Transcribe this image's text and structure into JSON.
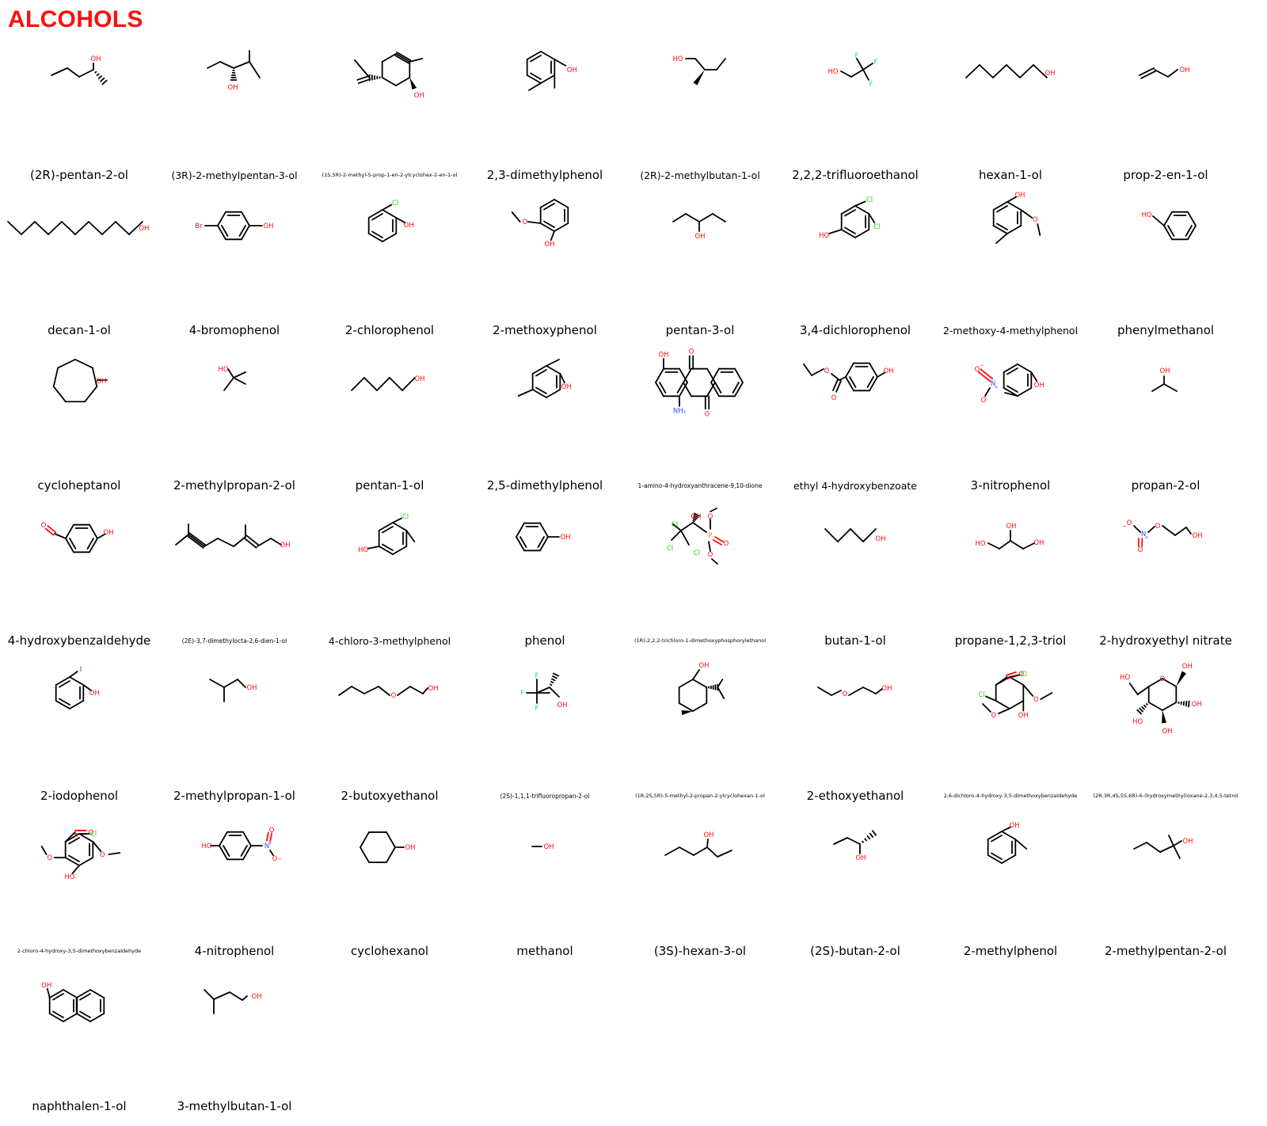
{
  "title": "ALCOHOLS",
  "colors": {
    "title": "#ff0d0d",
    "bond": "#000000",
    "O": "#ff0d0d",
    "N": "#3050f8",
    "Cl": "#1fd01f",
    "Br": "#a62929",
    "I": "#940094",
    "F": "#22c8d8",
    "P": "#ff8000"
  },
  "compounds": [
    {
      "name": "(2R)-pentan-2-ol",
      "structure": "pentan-2-ol skeletal structure"
    },
    {
      "name": "(3R)-2-methylpentan-3-ol",
      "structure": "2-methylpentan-3-ol skeletal structure"
    },
    {
      "name": "(1S,5R)-2-methyl-5-prop-1-en-2-ylcyclohex-2-en-1-ol",
      "structure": "carveol skeletal structure"
    },
    {
      "name": "2,3-dimethylphenol",
      "structure": "dimethylphenol skeletal structure"
    },
    {
      "name": "(2R)-2-methylbutan-1-ol",
      "structure": "2-methylbutan-1-ol skeletal structure"
    },
    {
      "name": "2,2,2-trifluoroethanol",
      "structure": "trifluoroethanol skeletal structure"
    },
    {
      "name": "hexan-1-ol",
      "structure": "hexanol skeletal structure"
    },
    {
      "name": "prop-2-en-1-ol",
      "structure": "allyl alcohol skeletal structure"
    },
    {
      "name": "decan-1-ol",
      "structure": "decanol skeletal structure"
    },
    {
      "name": "4-bromophenol",
      "structure": "bromophenol skeletal structure"
    },
    {
      "name": "2-chlorophenol",
      "structure": "chlorophenol skeletal structure"
    },
    {
      "name": "2-methoxyphenol",
      "structure": "guaiacol skeletal structure"
    },
    {
      "name": "pentan-3-ol",
      "structure": "pentan-3-ol skeletal structure"
    },
    {
      "name": "3,4-dichlorophenol",
      "structure": "dichlorophenol skeletal structure"
    },
    {
      "name": "2-methoxy-4-methylphenol",
      "structure": "creosol skeletal structure"
    },
    {
      "name": "phenylmethanol",
      "structure": "benzyl alcohol skeletal structure"
    },
    {
      "name": "cycloheptanol",
      "structure": "cycloheptanol skeletal structure"
    },
    {
      "name": "2-methylpropan-2-ol",
      "structure": "tert-butanol skeletal structure"
    },
    {
      "name": "pentan-1-ol",
      "structure": "pentanol skeletal structure"
    },
    {
      "name": "2,5-dimethylphenol",
      "structure": "dimethylphenol skeletal structure"
    },
    {
      "name": "1-amino-4-hydroxyanthracene-9,10-dione",
      "structure": "aminohydroxyanthraquinone skeletal structure"
    },
    {
      "name": "ethyl 4-hydroxybenzoate",
      "structure": "ethylparaben skeletal structure"
    },
    {
      "name": "3-nitrophenol",
      "structure": "3-nitrophenol skeletal structure"
    },
    {
      "name": "propan-2-ol",
      "structure": "isopropanol skeletal structure"
    },
    {
      "name": "4-hydroxybenzaldehyde",
      "structure": "hydroxybenzaldehyde skeletal structure"
    },
    {
      "name": "(2E)-3,7-dimethylocta-2,6-dien-1-ol",
      "structure": "geraniol skeletal structure"
    },
    {
      "name": "4-chloro-3-methylphenol",
      "structure": "chlorocresol skeletal structure"
    },
    {
      "name": "phenol",
      "structure": "phenol skeletal structure"
    },
    {
      "name": "(1R)-2,2,2-trichloro-1-dimethoxyphosphorylethanol",
      "structure": "trichlorfon skeletal structure"
    },
    {
      "name": "butan-1-ol",
      "structure": "butanol skeletal structure"
    },
    {
      "name": "propane-1,2,3-triol",
      "structure": "glycerol skeletal structure"
    },
    {
      "name": "2-hydroxyethyl nitrate",
      "structure": "hydroxyethyl nitrate skeletal structure"
    },
    {
      "name": "2-iodophenol",
      "structure": "iodophenol skeletal structure"
    },
    {
      "name": "2-methylpropan-1-ol",
      "structure": "isobutanol skeletal structure"
    },
    {
      "name": "2-butoxyethanol",
      "structure": "butoxyethanol skeletal structure"
    },
    {
      "name": "(2S)-1,1,1-trifluoropropan-2-ol",
      "structure": "trifluoropropanol skeletal structure"
    },
    {
      "name": "(1R,2S,5R)-5-methyl-2-propan-2-ylcyclohexan-1-ol",
      "structure": "menthol skeletal structure"
    },
    {
      "name": "2-ethoxyethanol",
      "structure": "ethoxyethanol skeletal structure"
    },
    {
      "name": "2,6-dichloro-4-hydroxy-3,5-dimethoxybenzaldehyde",
      "structure": "dichlorosyringaldehyde skeletal structure"
    },
    {
      "name": "(2R,3R,4S,5S,6R)-6-(hydroxymethyl)oxane-2,3,4,5-tetrol",
      "structure": "glucose skeletal structure"
    },
    {
      "name": "2-chloro-4-hydroxy-3,5-dimethoxybenzaldehyde",
      "structure": "chlorosyringaldehyde skeletal structure"
    },
    {
      "name": "4-nitrophenol",
      "structure": "4-nitrophenol skeletal structure"
    },
    {
      "name": "cyclohexanol",
      "structure": "cyclohexanol skeletal structure"
    },
    {
      "name": "methanol",
      "structure": "methanol skeletal structure"
    },
    {
      "name": "(3S)-hexan-3-ol",
      "structure": "hexan-3-ol skeletal structure"
    },
    {
      "name": "(2S)-butan-2-ol",
      "structure": "butan-2-ol skeletal structure"
    },
    {
      "name": "2-methylphenol",
      "structure": "o-cresol skeletal structure"
    },
    {
      "name": "2-methylpentan-2-ol",
      "structure": "2-methylpentan-2-ol skeletal structure"
    },
    {
      "name": "naphthalen-1-ol",
      "structure": "1-naphthol skeletal structure"
    },
    {
      "name": "3-methylbutan-1-ol",
      "structure": "isoamyl alcohol skeletal structure"
    }
  ]
}
